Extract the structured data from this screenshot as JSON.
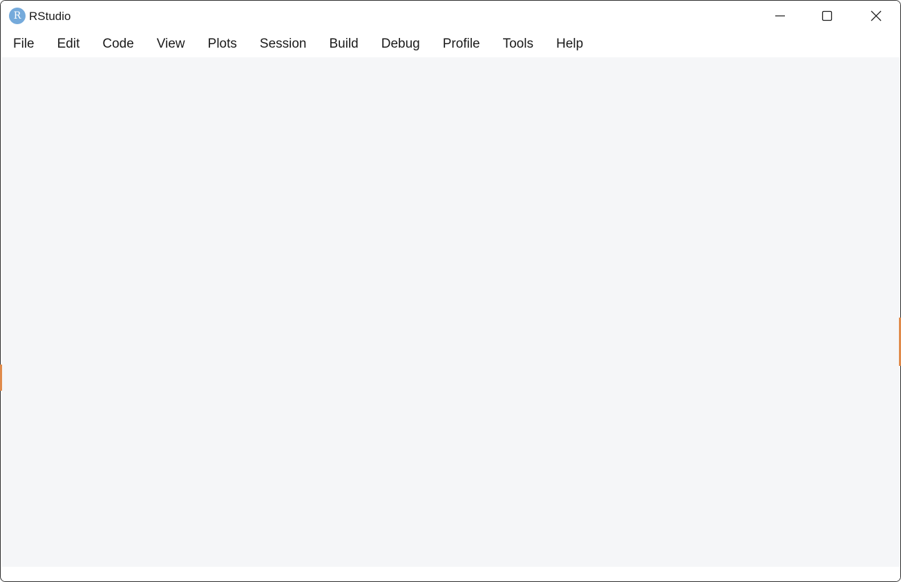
{
  "window": {
    "title": "RStudio",
    "logo_letter": "R",
    "logo_color": "#75aadb"
  },
  "controls": {
    "minimize_icon": "minimize-icon",
    "maximize_icon": "maximize-icon",
    "close_icon": "close-icon"
  },
  "menu": {
    "items": [
      {
        "label": "File"
      },
      {
        "label": "Edit"
      },
      {
        "label": "Code"
      },
      {
        "label": "View"
      },
      {
        "label": "Plots"
      },
      {
        "label": "Session"
      },
      {
        "label": "Build"
      },
      {
        "label": "Debug"
      },
      {
        "label": "Profile"
      },
      {
        "label": "Tools"
      },
      {
        "label": "Help"
      }
    ]
  },
  "colors": {
    "content_background": "#f5f6f8",
    "accent_edge": "#e08a4a"
  }
}
